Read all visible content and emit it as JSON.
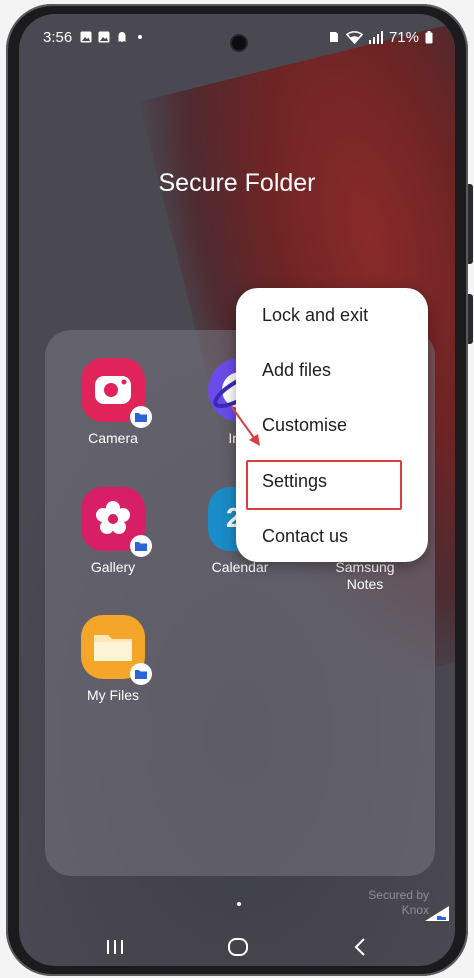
{
  "status": {
    "time": "3:56",
    "battery": "71%",
    "icons": [
      "image-icon",
      "image-icon",
      "ghost-icon",
      "dot-icon"
    ]
  },
  "title": "Secure Folder",
  "apps": [
    {
      "label": "Camera",
      "icon": "camera-icon",
      "color": "#e0245a"
    },
    {
      "label": "Internet",
      "shown": "Inte",
      "icon": "internet-icon",
      "color": "#6a4be8"
    },
    {
      "label": "Gallery",
      "icon": "flower-icon",
      "color": "#d81f66"
    },
    {
      "label": "Calendar",
      "icon": "calendar-icon",
      "color": "#1a8cc7",
      "day": "2"
    },
    {
      "label": "Samsung\nNotes",
      "line1": "Samsung",
      "line2": "Notes"
    },
    {
      "label": "My Files",
      "icon": "folder-icon",
      "color": "#f4a62a"
    }
  ],
  "menu": {
    "items": [
      "Lock and exit",
      "Add files",
      "Customise",
      "Settings",
      "Contact us"
    ],
    "highlighted": "Settings",
    "highlight_color": "#d8403f"
  },
  "knox": {
    "line1": "Secured by",
    "line2": "Knox"
  }
}
